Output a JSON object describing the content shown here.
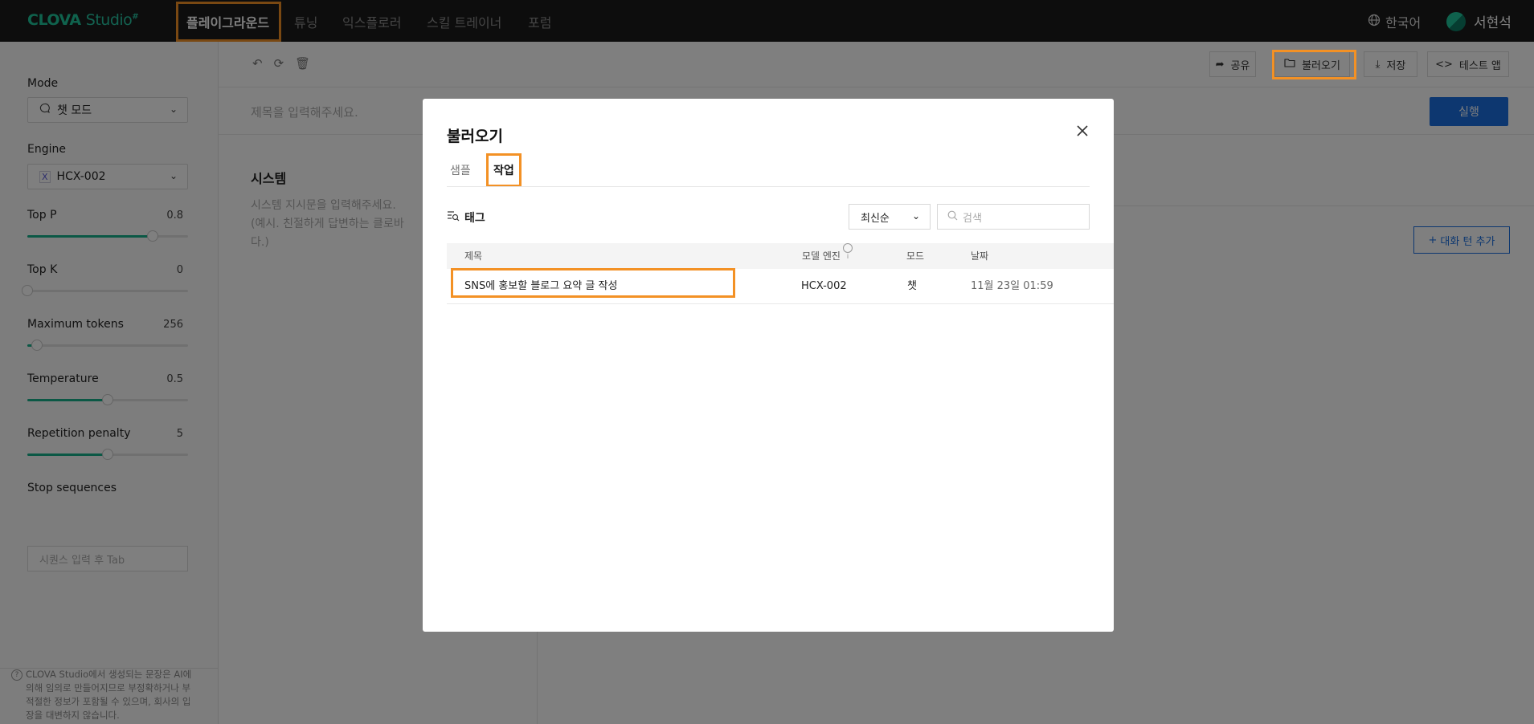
{
  "nav": {
    "logo_main": "CLOVA",
    "logo_studio": "Studio",
    "logo_sup": "#",
    "items": [
      "플레이그라운드",
      "튜닝",
      "익스플로러",
      "스킬 트레이너",
      "포럼"
    ],
    "language": "한국어",
    "user_name": "서현석"
  },
  "sidebar": {
    "mode_label": "Mode",
    "mode_value": "챗 모드",
    "engine_label": "Engine",
    "engine_value": "HCX-002",
    "params": [
      {
        "label": "Top P",
        "value": "0.8",
        "fraction": 0.78
      },
      {
        "label": "Top K",
        "value": "0",
        "fraction": 0.0
      },
      {
        "label": "Maximum tokens",
        "value": "256",
        "fraction": 0.06
      },
      {
        "label": "Temperature",
        "value": "0.5",
        "fraction": 0.5
      },
      {
        "label": "Repetition penalty",
        "value": "5",
        "fraction": 0.5
      }
    ],
    "stop_label": "Stop sequences",
    "stop_placeholder": "시퀀스 입력 후 Tab",
    "disclaimer": "CLOVA Studio에서 생성되는 문장은 AI에 의해 임의로 만들어지므로 부정확하거나 부적절한 정보가 포함될 수 있으며, 회사의 입장을 대변하지 않습니다."
  },
  "toolbar": {
    "share": "공유",
    "load": "불러오기",
    "save": "저장",
    "test_app": "테스트 앱"
  },
  "main": {
    "title_placeholder": "제목을 입력해주세요.",
    "run": "실행",
    "system_title": "시스템",
    "system_placeholder": "시스템 지시문을 입력해주세요.\n(예시. 친절하게 답변하는 클로바 어시스턴트입니다.)",
    "system_line1": "시스템 지시문을 입력해주세요.",
    "system_line2": "(예시. 친절하게 답변하는 클로바",
    "system_line3": "다.)",
    "add_turn": "대화 턴 추가"
  },
  "modal": {
    "title": "불러오기",
    "tabs": [
      "샘플",
      "작업"
    ],
    "tag_label": "태그",
    "sort_value": "최신순",
    "search_placeholder": "검색",
    "columns": [
      "제목",
      "모델 엔진",
      "모드",
      "날짜"
    ],
    "rows": [
      {
        "title": "SNS에 홍보할 블로그 요약 글 작성",
        "engine": "HCX-002",
        "mode": "챗",
        "date": "11월 23일 01:59"
      }
    ]
  },
  "colors": {
    "accent": "#f39125",
    "brand": "#1fc59a",
    "primary": "#1a6fe0"
  }
}
